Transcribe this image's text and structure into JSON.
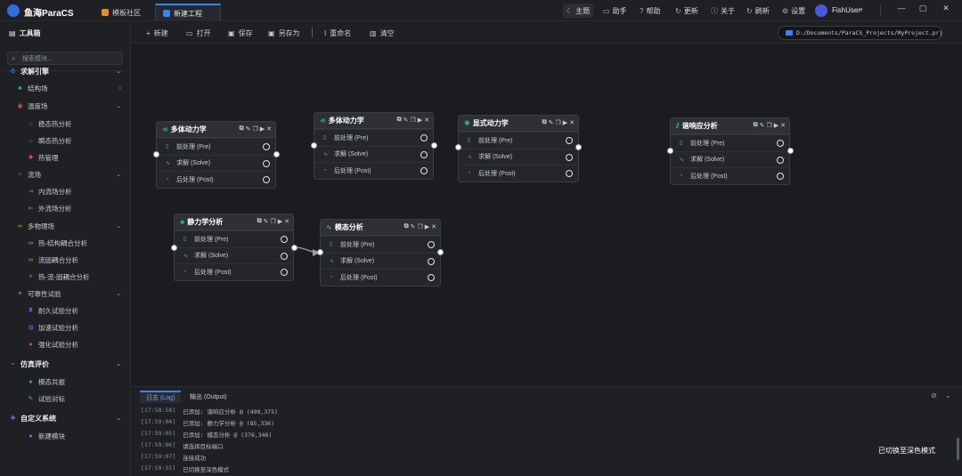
{
  "app": {
    "title": "鱼海ParaCS"
  },
  "tabs": [
    {
      "label": "模板社区"
    },
    {
      "label": "新建工程"
    }
  ],
  "topnav": {
    "theme": "主题",
    "assistant": "助手",
    "help": "帮助",
    "update": "更新",
    "about": "关于",
    "refresh": "刷新",
    "settings": "设置"
  },
  "user": {
    "name": "FishUser"
  },
  "sidebar": {
    "title": "工具箱",
    "search_placeholder": "搜索模块...",
    "items": [
      {
        "label": "求解引擎",
        "level": 0,
        "icon": "gear-icon",
        "color": "#3b82f6",
        "chevron": "down"
      },
      {
        "label": "结构场",
        "level": 1,
        "icon": "structure-icon",
        "color": "#22c55e",
        "chevron": "right"
      },
      {
        "label": "温度场",
        "level": 1,
        "icon": "thermometer-icon",
        "color": "#ef4444",
        "chevron": "down"
      },
      {
        "label": "稳态热分析",
        "level": 2,
        "icon": "flame-icon",
        "color": "#ef4444"
      },
      {
        "label": "瞬态热分析",
        "level": 2,
        "icon": "flame-icon",
        "color": "#ef4444"
      },
      {
        "label": "热管理",
        "level": 2,
        "icon": "heat-icon",
        "color": "#ef4444"
      },
      {
        "label": "流场",
        "level": 1,
        "icon": "wave-icon",
        "color": "#3b82f6",
        "chevron": "down"
      },
      {
        "label": "内流场分析",
        "level": 2,
        "icon": "inflow-icon",
        "color": "#3b82f6"
      },
      {
        "label": "外流场分析",
        "level": 2,
        "icon": "outflow-icon",
        "color": "#3b82f6"
      },
      {
        "label": "多物理场",
        "level": 1,
        "icon": "link-icon",
        "color": "#f59e0b",
        "chevron": "down"
      },
      {
        "label": "热-结构耦合分析",
        "level": 2,
        "icon": "link-icon",
        "color": "#f59e0b"
      },
      {
        "label": "流固耦合分析",
        "level": 2,
        "icon": "link-icon",
        "color": "#f59e0b"
      },
      {
        "label": "热-流-固耦合分析",
        "level": 2,
        "icon": "bolt-icon",
        "color": "#f59e0b"
      },
      {
        "label": "可靠性试验",
        "level": 1,
        "icon": "test-icon",
        "color": "#a855f7",
        "chevron": "down"
      },
      {
        "label": "耐久试验分析",
        "level": 2,
        "icon": "hourglass-icon",
        "color": "#a855f7"
      },
      {
        "label": "加速试验分析",
        "level": 2,
        "icon": "speed-icon",
        "color": "#a855f7"
      },
      {
        "label": "强化试验分析",
        "level": 2,
        "icon": "dumbbell-icon",
        "color": "#ec4899"
      },
      {
        "label": "仿真评价",
        "level": 0,
        "icon": "chart-icon",
        "color": "#22c55e",
        "chevron": "down"
      },
      {
        "label": "模态共振",
        "level": 2,
        "icon": "tree-icon",
        "color": "#22c55e"
      },
      {
        "label": "试验对标",
        "level": 2,
        "icon": "pen-icon",
        "color": "#22c55e"
      },
      {
        "label": "自定义系统",
        "level": 0,
        "icon": "puzzle-icon",
        "color": "#a855f7",
        "chevron": "down"
      },
      {
        "label": "新建模块",
        "level": 2,
        "icon": "dot-icon",
        "color": "#a855f7"
      }
    ]
  },
  "toolbar": {
    "new": "新建",
    "open": "打开",
    "save": "保存",
    "save_as": "另存为",
    "rename": "重命名",
    "clear": "清空",
    "path": "D:/Documents/ParaCS_Projects/MyProject.prj"
  },
  "nodes": {
    "n1": {
      "title": "多体动力学",
      "icon_color": "#22c55e",
      "ports": [
        "前处理 (Pre)",
        "求解 (Solve)",
        "后处理 (Post)"
      ]
    },
    "n2": {
      "title": "多体动力学",
      "icon_color": "#22c55e",
      "ports": [
        "前处理 (Pre)",
        "求解 (Solve)",
        "后处理 (Post)"
      ]
    },
    "n3": {
      "title": "显式动力学",
      "icon_color": "#22c55e",
      "ports": [
        "前处理 (Pre)",
        "求解 (Solve)",
        "后处理 (Post)"
      ]
    },
    "n4": {
      "title": "谐响应分析",
      "icon_color": "#22c55e",
      "ports": [
        "前处理 (Pre)",
        "求解 (Solve)",
        "后处理 (Post)"
      ]
    },
    "n5": {
      "title": "静力学分析",
      "icon_color": "#22c55e",
      "ports": [
        "前处理 (Pre)",
        "求解 (Solve)",
        "后处理 (Post)"
      ]
    },
    "n6": {
      "title": "模态分析",
      "icon_color": "#22c55e",
      "ports": [
        "前处理 (Pre)",
        "求解 (Solve)",
        "后处理 (Post)"
      ]
    }
  },
  "log": {
    "tabs": [
      "日志 (Log)",
      "输出 (Output)"
    ],
    "lines": [
      {
        "time": "[17:58:58]",
        "text": "已添加: 谐响应分析 @ (498,375)"
      },
      {
        "time": "[17:59:04]",
        "text": "已添加: 静力学分析 @ (85,336)"
      },
      {
        "time": "[17:59:05]",
        "text": "已添加: 模态分析 @ (376,346)"
      },
      {
        "time": "[17:59:06]",
        "text": "请选择目标端口"
      },
      {
        "time": "[17:59:07]",
        "text": "连接成功"
      },
      {
        "time": "[17:59:55]",
        "text": "已切换至深色模式"
      }
    ]
  },
  "toast": "已切换至深色模式",
  "colors": {
    "accent": "#3b82f6",
    "background": "#1b1c1f",
    "panel": "#1f2024"
  }
}
